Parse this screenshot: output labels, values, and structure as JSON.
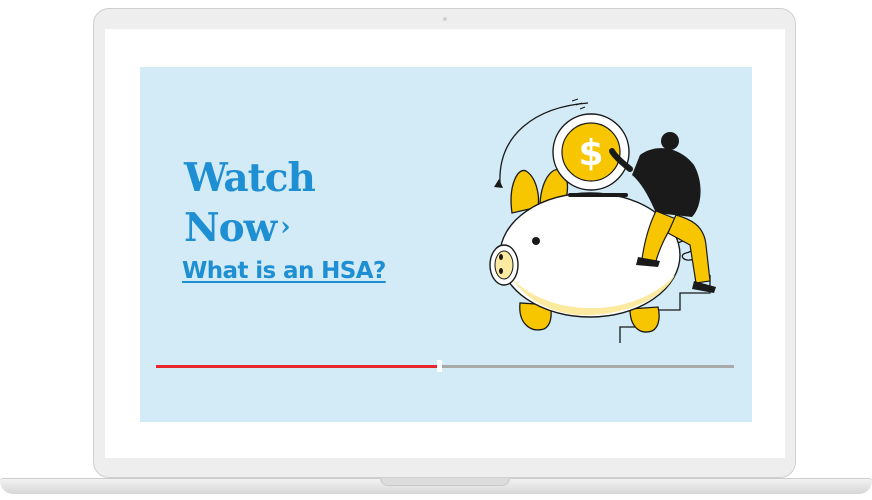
{
  "video": {
    "cta_line1": "Watch",
    "cta_line2": "Now",
    "cta_chevron": "›",
    "subtitle_link": "What is an HSA?",
    "progress_fraction": 0.49
  },
  "colors": {
    "accent_blue": "#1e8fd2",
    "background": "#d2ebf6",
    "progress_played": "#e8262e",
    "progress_remaining": "#a9a9a9",
    "coin_yellow": "#f7c600",
    "piggy_bank": "#ffffff"
  },
  "illustration": {
    "coin_symbol": "$",
    "icon": "piggy-bank-coin-illustration"
  }
}
